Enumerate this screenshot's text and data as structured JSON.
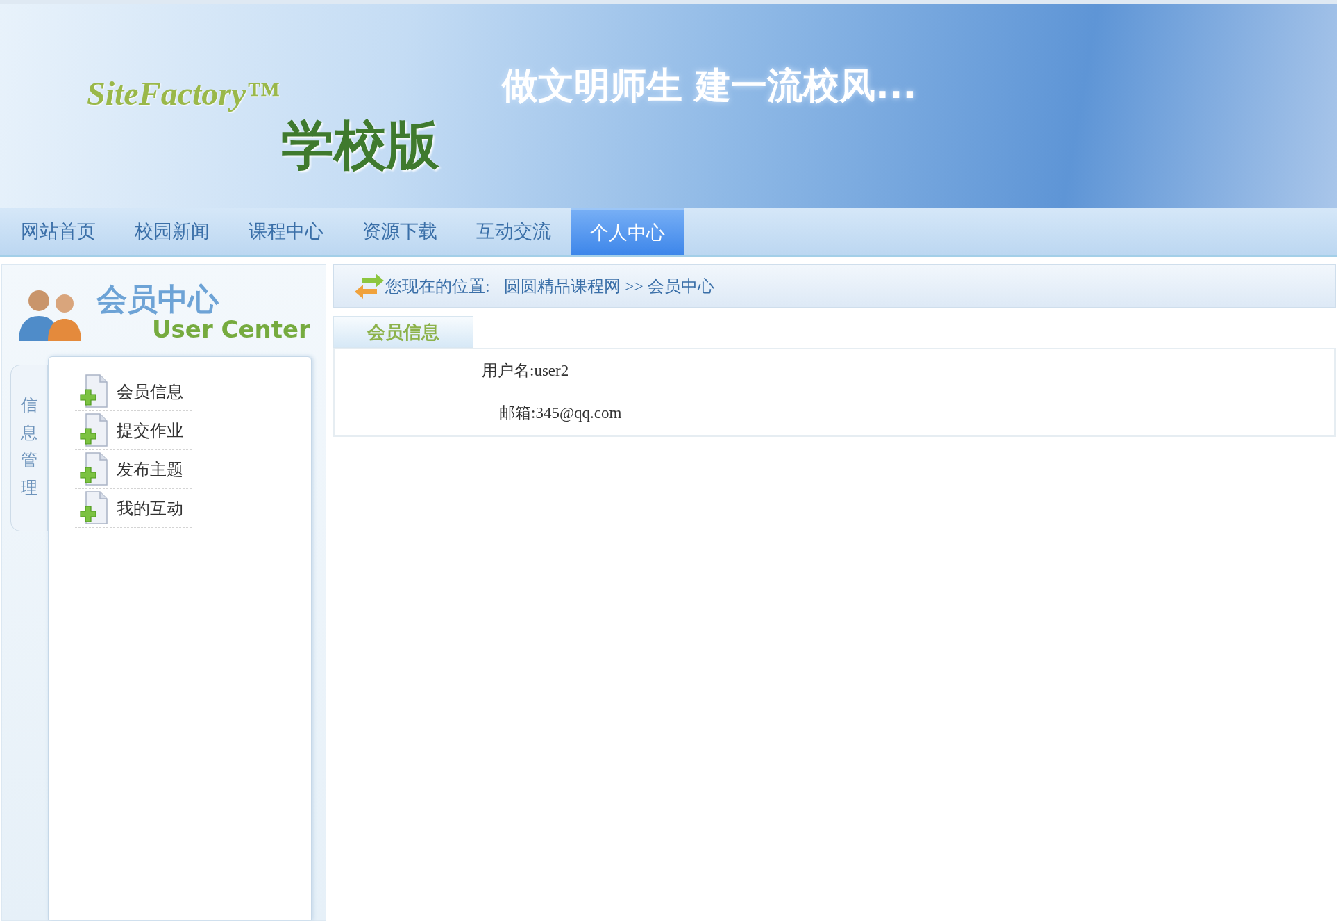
{
  "banner": {
    "logo": "SiteFactory™",
    "edition": "学校版",
    "slogan": "做文明师生 建一流校风..."
  },
  "nav": [
    {
      "label": "网站首页",
      "selected": false
    },
    {
      "label": "校园新闻",
      "selected": false
    },
    {
      "label": "课程中心",
      "selected": false
    },
    {
      "label": "资源下载",
      "selected": false
    },
    {
      "label": "互动交流",
      "selected": false
    },
    {
      "label": "个人中心",
      "selected": true
    }
  ],
  "sidebar": {
    "title": "会员中心",
    "subtitle": "User Center",
    "tab": "信息管理",
    "items": [
      "会员信息",
      "提交作业",
      "发布主题",
      "我的互动"
    ]
  },
  "breadcrumb": {
    "label": "您现在的位置:",
    "path": [
      {
        "text": "圆圆精品课程网"
      },
      {
        "text": ">>"
      },
      {
        "text": "会员中心"
      }
    ]
  },
  "panel": {
    "tab": "会员信息",
    "fields": [
      {
        "label": "用户名:",
        "value": "user2"
      },
      {
        "label": "邮箱:",
        "value": "345@qq.com"
      }
    ]
  }
}
